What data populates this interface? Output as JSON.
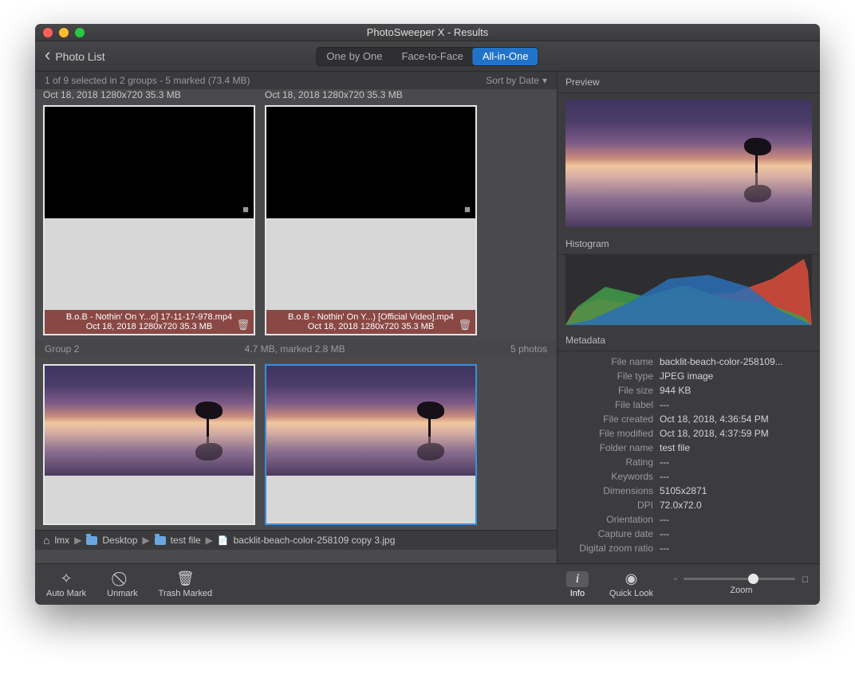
{
  "window": {
    "title": "PhotoSweeper X - Results"
  },
  "toolbar": {
    "back_label": "Photo List",
    "views": {
      "one_by_one": "One by One",
      "face_to_face": "Face-to-Face",
      "all_in_one": "All-in-One"
    }
  },
  "subheader": {
    "status": "1 of 9 selected in 2 groups - 5 marked (73.4 MB)",
    "sort_label": "Sort by Date"
  },
  "group1": {
    "top_cards": [
      {
        "info": "Oct 18, 2018  1280x720  35.3 MB"
      },
      {
        "info": "Oct 18, 2018  1280x720  35.3 MB"
      }
    ],
    "cards": [
      {
        "filename": "B.o.B - Nothin' On Y...o] 17-11-17-978.mp4",
        "info": "Oct 18, 2018  1280x720  35.3 MB"
      },
      {
        "filename": "B.o.B - Nothin' On Y...) [Official Video].mp4",
        "info": "Oct 18, 2018  1280x720  35.3 MB"
      }
    ]
  },
  "group2": {
    "label": "Group 2",
    "summary": "4.7 MB, marked 2.8 MB",
    "count": "5 photos"
  },
  "breadcrumb": {
    "user": "lmx",
    "p1": "Desktop",
    "p2": "test file",
    "file": "backlit-beach-color-258109 copy 3.jpg"
  },
  "footer": {
    "auto_mark": "Auto Mark",
    "unmark": "Unmark",
    "trash_marked": "Trash Marked",
    "info": "Info",
    "quick_look": "Quick Look",
    "zoom": "Zoom"
  },
  "right": {
    "preview_label": "Preview",
    "histogram_label": "Histogram",
    "metadata_label": "Metadata",
    "meta": [
      {
        "k": "File name",
        "v": "backlit-beach-color-258109..."
      },
      {
        "k": "File type",
        "v": "JPEG image"
      },
      {
        "k": "File size",
        "v": "944 KB"
      },
      {
        "k": "File label",
        "v": "---"
      },
      {
        "k": "File created",
        "v": "Oct 18, 2018, 4:36:54 PM"
      },
      {
        "k": "File modified",
        "v": "Oct 18, 2018, 4:37:59 PM"
      },
      {
        "k": "Folder name",
        "v": "test file"
      },
      {
        "k": "Rating",
        "v": "---"
      },
      {
        "k": "Keywords",
        "v": "---"
      },
      {
        "k": "Dimensions",
        "v": "5105x2871"
      },
      {
        "k": "DPI",
        "v": "72.0x72.0"
      },
      {
        "k": "Orientation",
        "v": "---"
      },
      {
        "k": "Capture date",
        "v": "---"
      },
      {
        "k": "Digital zoom ratio",
        "v": "---"
      }
    ]
  }
}
